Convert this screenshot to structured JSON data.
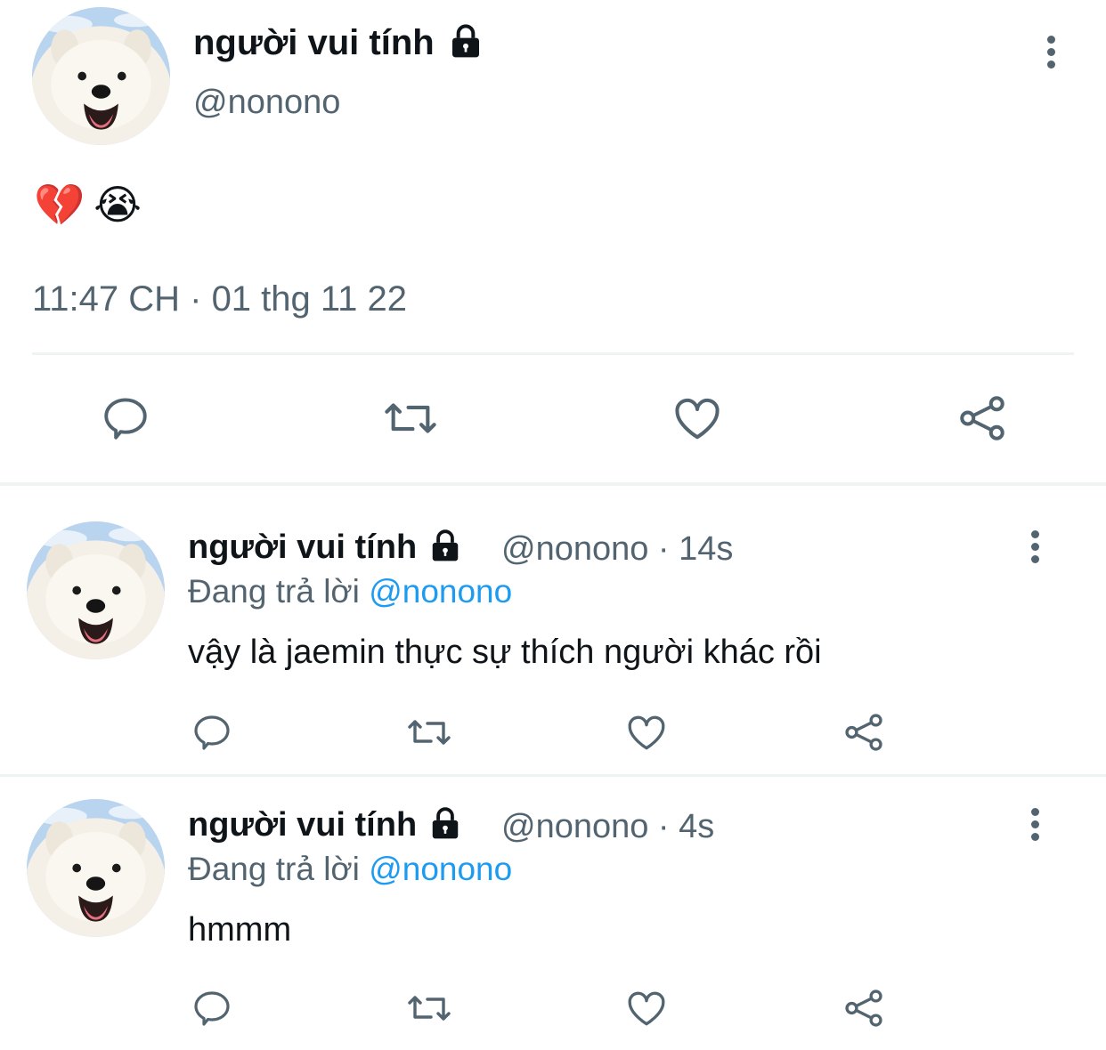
{
  "main_tweet": {
    "display_name": "người vui tính",
    "handle": "@nonono",
    "emojis": [
      "💔",
      "😭"
    ],
    "timestamp": "11:47 CH · 01 thg 11 22"
  },
  "replies": [
    {
      "display_name": "người vui tính",
      "handle_time": "@nonono · 14s",
      "replying_label": "Đang trả lời",
      "replying_to": "@nonono",
      "text": "vậy là jaemin thực sự thích người khác rồi"
    },
    {
      "display_name": "người vui tính",
      "handle_time": "@nonono · 4s",
      "replying_label": "Đang trả lời",
      "replying_to": "@nonono",
      "text": "hmmm"
    }
  ],
  "colors": {
    "text": "#0f1419",
    "secondary": "#536471",
    "accent": "#1d9bf0",
    "divider": "#eff3f4"
  }
}
